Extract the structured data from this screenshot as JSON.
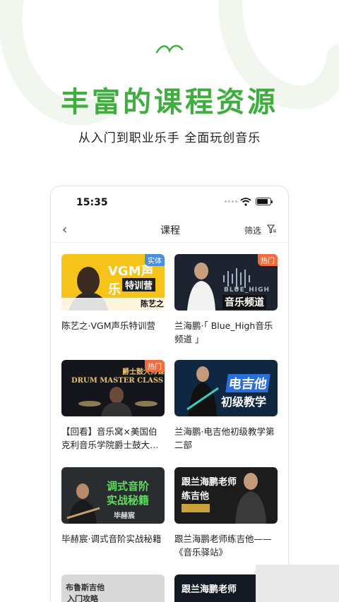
{
  "hero": {
    "title": "丰富的课程资源",
    "subtitle": "从入门到职业乐手 全面玩创音乐"
  },
  "status_bar": {
    "time": "15:35"
  },
  "nav": {
    "title": "课程",
    "filter_label": "筛选"
  },
  "courses": [
    {
      "title": "陈艺之·VGM声乐特训营",
      "badge": "实体",
      "thumb_main": "VGM声乐",
      "thumb_sub": "特训营",
      "thumb_tag": "陈艺之"
    },
    {
      "title": "兰海鹏·「 Blue_High音乐频道 」",
      "badge": "热门",
      "thumb_main": "BLUE_HIGH",
      "thumb_sub": "音乐频道"
    },
    {
      "title": "【回看】音乐窝×美国伯克利音乐学院爵士鼓大…",
      "badge": "热门",
      "thumb_main": "DRUM MASTER CLASS",
      "thumb_sub": "爵士鼓大师课"
    },
    {
      "title": "兰海鹏·电吉他初级教学第二部",
      "badge": "",
      "thumb_main": "电吉他",
      "thumb_sub": "初级教学"
    },
    {
      "title": "毕赫宸·调式音阶实战秘籍",
      "badge": "",
      "thumb_main": "调式音阶",
      "thumb_sub": "实战秘籍",
      "thumb_tag": "毕赫宸"
    },
    {
      "title": "跟兰海鹏老师练吉他——《音乐驿站》",
      "badge": "",
      "thumb_main": "跟兰海鹏老师",
      "thumb_sub": "练吉他"
    },
    {
      "title": "",
      "badge": "",
      "thumb_main": "布鲁斯吉他",
      "thumb_sub": "入门攻略"
    },
    {
      "title": "",
      "badge": "",
      "thumb_main": "跟兰海鹏老师",
      "thumb_sub": ""
    }
  ],
  "colors": {
    "accent_green": "#3fae3f",
    "badge_blue": "#4a90d9",
    "badge_orange": "#f26b3a"
  }
}
